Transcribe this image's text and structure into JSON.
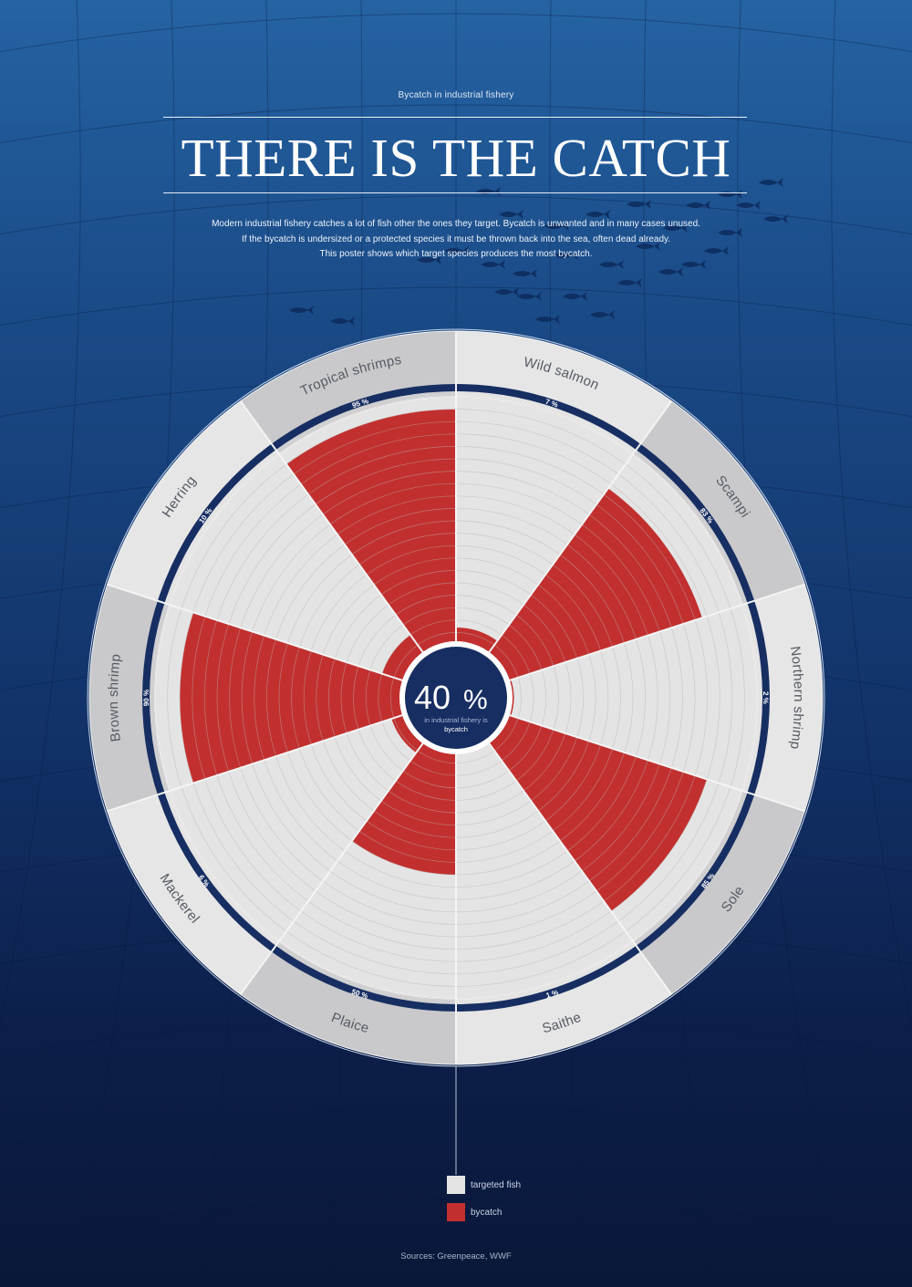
{
  "header": {
    "kicker": "Bycatch in industrial fishery",
    "title": "THERE IS THE CATCH",
    "intro_lines": [
      "Modern industrial fishery catches a lot of fish other the ones they target. Bycatch is unwanted and in many cases unused.",
      "If the bycatch is undersized or a protected species it must be thrown back into the sea, often dead already.",
      "This poster shows which target species produces the most bycatch."
    ]
  },
  "center": {
    "value": "40",
    "unit": "%",
    "line1": "in industrial fishery is",
    "line2": "bycatch"
  },
  "chart_data": {
    "type": "polar-bar",
    "max": 100,
    "categories": [
      "Wild salmon",
      "Scampi",
      "Northern shrimp",
      "Sole",
      "Saithe",
      "Plaice",
      "Mackerel",
      "Brown shrimp",
      "Herring",
      "Tropical shrimps"
    ],
    "series": [
      {
        "name": "bycatch",
        "values": [
          7,
          83,
          2,
          85,
          1,
          50,
          6,
          90,
          10,
          95
        ],
        "labels": [
          "7 %",
          "83 %",
          "2 %",
          "85 %",
          "1 %",
          "50 %",
          "6 %",
          "90 %",
          "10 %",
          "95 %"
        ]
      }
    ],
    "center_value": 40
  },
  "legend": {
    "items": [
      {
        "label": "targeted fish",
        "color": "#e4e4e4"
      },
      {
        "label": "bycatch",
        "color": "#c1302f"
      }
    ]
  },
  "sources": "Sources: Greenpeace, WWF",
  "colors": {
    "targeted": "#e4e4e4",
    "bycatch": "#c1302f",
    "navy": "#172e62",
    "shade": "#c9c9cb"
  }
}
